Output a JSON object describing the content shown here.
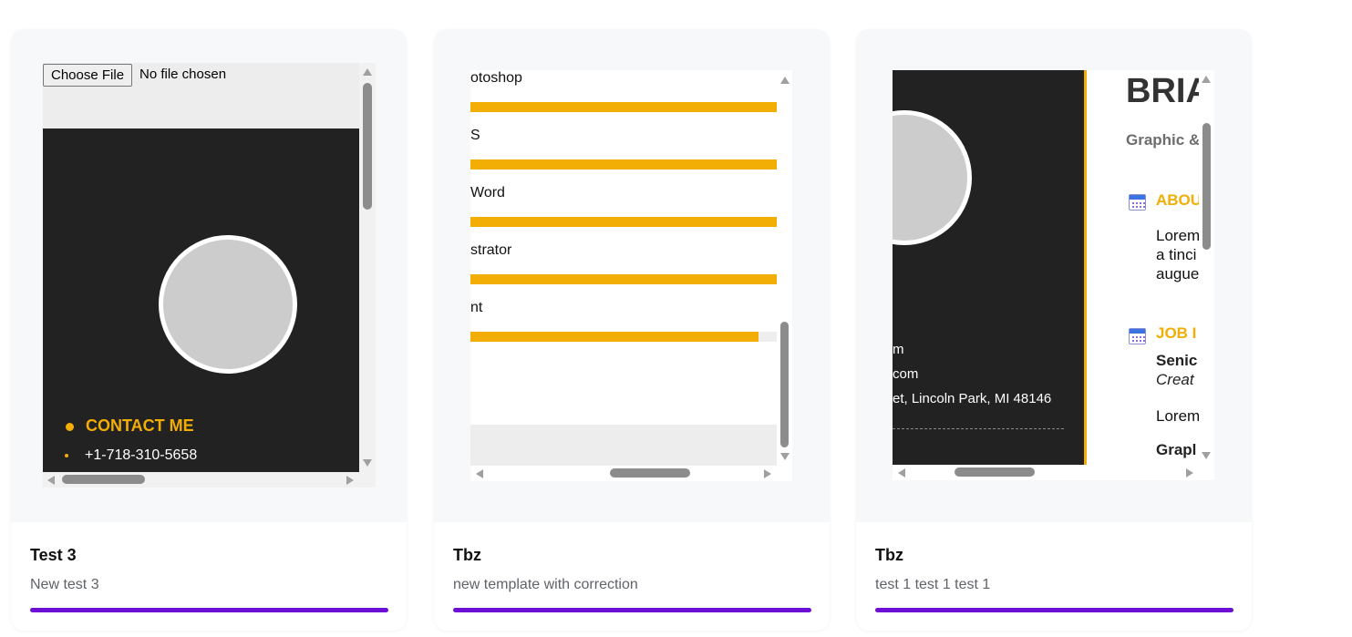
{
  "cards": [
    {
      "title": "Test 3",
      "description": "New test 3",
      "preview": {
        "file_button": "Choose File",
        "file_status": "No file chosen",
        "contact_heading": "CONTACT ME",
        "phone": "+1-718-310-5658"
      }
    },
    {
      "title": "Tbz",
      "description": "new template with correction",
      "preview": {
        "skills": [
          {
            "label": "otoshop",
            "level": 1.0
          },
          {
            "label": "S",
            "level": 1.0
          },
          {
            "label": "Word",
            "level": 1.0
          },
          {
            "label": "strator",
            "level": 1.0
          },
          {
            "label": "nt",
            "level": 0.94
          }
        ]
      }
    },
    {
      "title": "Tbz",
      "description": "test 1 test 1 test 1",
      "preview": {
        "name": "BRIA",
        "role": "Graphic &",
        "contact_lines": [
          "m",
          "com",
          "et, Lincoln Park, MI 48146"
        ],
        "about_heading": "ABOU",
        "about_lines": [
          "Lorem",
          "a tinci",
          "augue"
        ],
        "job_heading": "JOB I",
        "job_title": "Senic",
        "job_company": "Creat",
        "job_desc": "Lorem",
        "job_title_2": "Grapl"
      }
    }
  ],
  "colors": {
    "accent_bar": "#6e0fd6",
    "resume_yellow": "#f2ae04",
    "resume_dark": "#222222"
  }
}
